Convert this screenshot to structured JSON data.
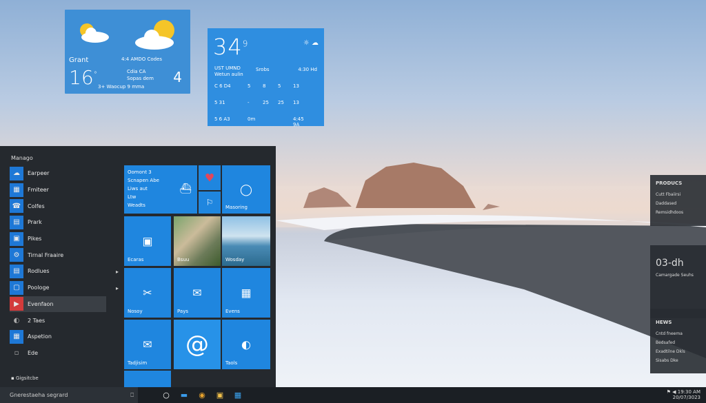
{
  "weather_card_1": {
    "place": "Grant",
    "subtitle": "4:4 AMDO Codes",
    "temperature": "16",
    "temperature_unit": "°",
    "line1": "Cdia CA",
    "line2": "Sopas dem",
    "line3": "3+ Waocup 9 mma",
    "side_number": "4"
  },
  "weather_card_2": {
    "big_value": "34",
    "big_super": "9",
    "header_left": "UST UMND",
    "header_left_sub": "Wetun aulin",
    "header_mid": "Srobs",
    "header_right": "4:30 Hd",
    "grid": [
      [
        "C  6 D4",
        "5",
        "8",
        "5",
        "13"
      ],
      [
        "5  31",
        "-",
        "25",
        "25",
        "13"
      ],
      [
        "5  6 A3",
        "0m",
        "",
        "",
        "4:45 9A"
      ]
    ]
  },
  "start_menu": {
    "title": "Manago",
    "apps": [
      {
        "icon": "☁",
        "label": "Earpeer"
      },
      {
        "icon": "▦",
        "label": "Fmiteer"
      },
      {
        "icon": "☎",
        "label": "Colfes"
      },
      {
        "icon": "▤",
        "label": "Prark"
      },
      {
        "icon": "▣",
        "label": "Pikes"
      },
      {
        "icon": "⚙",
        "label": "Tirnal Fraaire"
      },
      {
        "icon": "▤",
        "label": "Rodlues"
      },
      {
        "icon": "▢",
        "label": "Poologe"
      },
      {
        "icon": "▶",
        "label": "Evenfaon"
      },
      {
        "icon": "◐",
        "label": "2 Taes"
      },
      {
        "icon": "▦",
        "label": "Aspetion"
      },
      {
        "icon": "▫",
        "label": "Ede"
      }
    ],
    "power_label": "Gigsitcbe"
  },
  "tiles": [
    {
      "label": "Oomont 3\nScnapen Abe\nLiws aut\nLtw\nWeadts",
      "icon": ""
    },
    {
      "label": "",
      "icon": "♥"
    },
    {
      "label": "",
      "icon": "◯"
    },
    {
      "label": "",
      "icon": "⚐"
    },
    {
      "label": "Masoring",
      "icon": ""
    },
    {
      "label": "Ecaras",
      "icon": "▣"
    },
    {
      "label": "Bsuu",
      "icon": ""
    },
    {
      "label": "Wosday",
      "icon": ""
    },
    {
      "label": "Nosoy",
      "icon": "✂"
    },
    {
      "label": "Pays",
      "icon": "✉"
    },
    {
      "label": "Evens",
      "icon": "▦"
    },
    {
      "label": "Tadjisim",
      "icon": "✉"
    },
    {
      "label": "",
      "icon": "@"
    },
    {
      "label": "Taols",
      "icon": "◐"
    }
  ],
  "taskbar": {
    "search_placeholder": "Gnerestaeha segrard",
    "clock_time": "19:30 AM",
    "clock_date": "20/07/3023"
  },
  "right_panels": [
    {
      "title": "PRODUCS",
      "items": [
        "Cutt Fbaiirsi",
        "Daddased",
        "Remsidhdoos"
      ]
    },
    {
      "title": "03-dh",
      "items": [
        "Camargade Seuhs"
      ]
    },
    {
      "title": "HEWS",
      "items": [
        "Cntd fneema",
        "Bedsafed",
        "Exadtilne Dkls",
        "Sisabs Dke"
      ]
    }
  ]
}
